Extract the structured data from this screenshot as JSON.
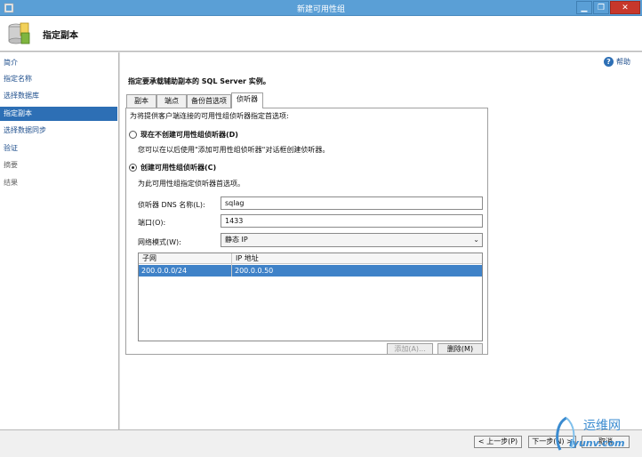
{
  "window": {
    "title": "新建可用性组",
    "minimize": "▁",
    "maximize": "❐",
    "close": "✕"
  },
  "header": {
    "title": "指定副本"
  },
  "sidebar": {
    "items": [
      {
        "label": "简介"
      },
      {
        "label": "指定名称"
      },
      {
        "label": "选择数据库"
      },
      {
        "label": "指定副本"
      },
      {
        "label": "选择数据同步"
      },
      {
        "label": "验证"
      },
      {
        "label": "摘要"
      },
      {
        "label": "结果"
      }
    ]
  },
  "help": {
    "label": "帮助"
  },
  "main": {
    "instruction": "指定要承载辅助副本的 SQL Server 实例。",
    "tabs": [
      {
        "label": "副本"
      },
      {
        "label": "端点"
      },
      {
        "label": "备份首选项"
      },
      {
        "label": "侦听器"
      }
    ],
    "panel_intro": "为将提供客户端连接的可用性组侦听器指定首选项:",
    "option_none": {
      "label": "现在不创建可用性组侦听器(D)",
      "desc": "您可以在以后使用\"添加可用性组侦听器\"对话框创建侦听器。"
    },
    "option_create": {
      "label": "创建可用性组侦听器(C)",
      "desc": "为此可用性组指定侦听器首选项。"
    },
    "dns": {
      "label": "侦听器 DNS 名称(L):",
      "value": "sqlag"
    },
    "port": {
      "label": "端口(O):",
      "value": "1433"
    },
    "network_mode": {
      "label": "网络模式(W):",
      "value": "静态 IP"
    },
    "grid": {
      "headers": [
        "子网",
        "IP 地址"
      ],
      "rows": [
        {
          "subnet": "200.0.0.0/24",
          "ip": "200.0.0.50"
        }
      ]
    },
    "add_button": "添加(A)...",
    "remove_button": "删除(M)"
  },
  "footer": {
    "prev": "< 上一步(P)",
    "next": "下一步(N) >",
    "cancel": "取消"
  },
  "watermark": {
    "text": "运维网",
    "url": "iyunv.com"
  }
}
